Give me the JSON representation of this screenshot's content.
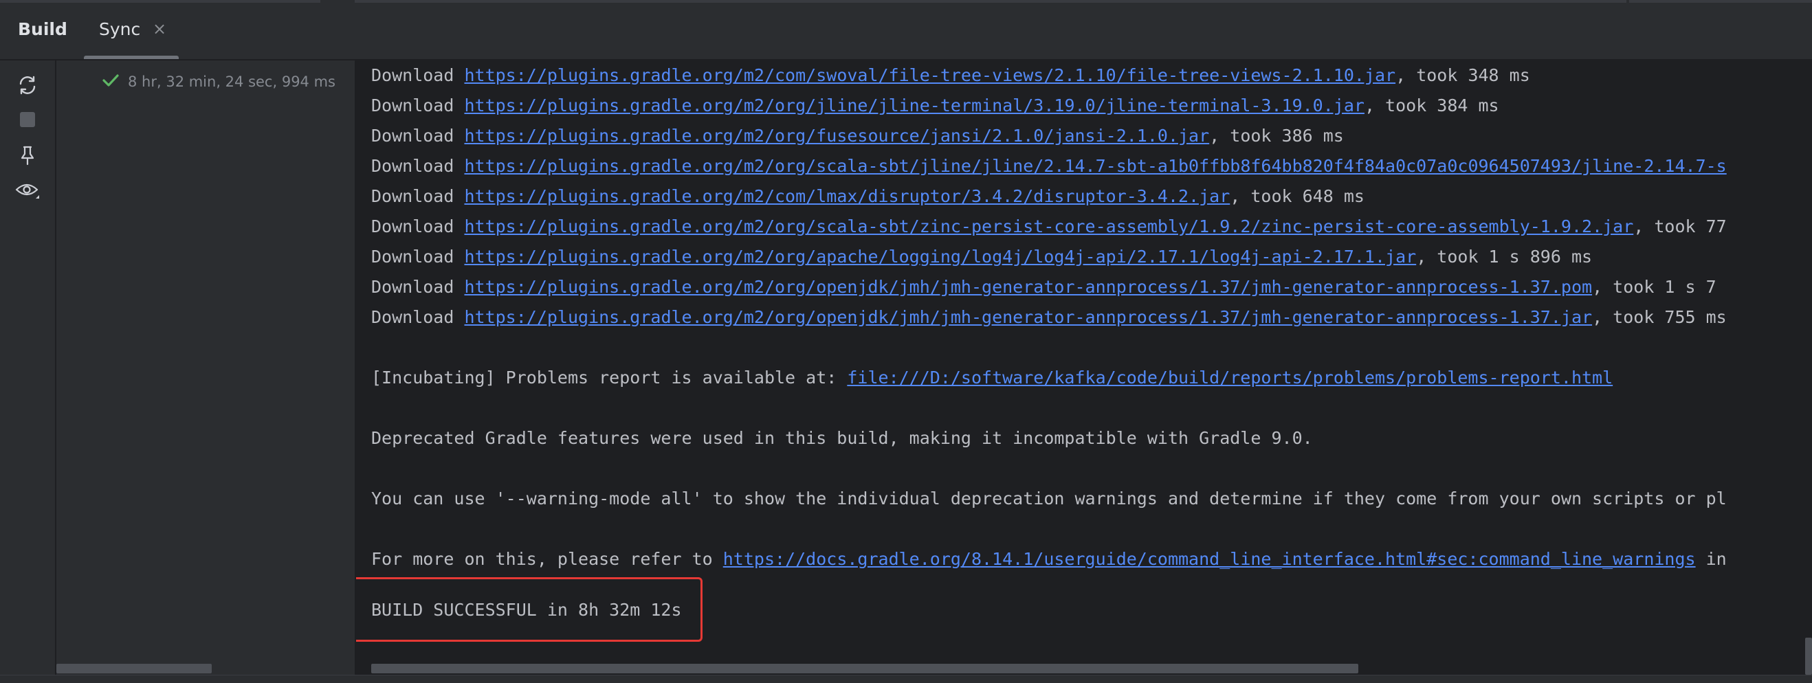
{
  "tabs": {
    "build_label": "Build",
    "sync_label": "Sync",
    "close_glyph": "×"
  },
  "toolbar_icons": [
    "sync-icon",
    "stop-icon",
    "pin-icon",
    "eye-icon"
  ],
  "tree": {
    "status_icon": "check-icon",
    "status_color": "#5fb865",
    "elapsed": "8 hr, 32 min, 24 sec, 994 ms"
  },
  "console": {
    "downloads": [
      {
        "prefix": "Download ",
        "url": "https://plugins.gradle.org/m2/com/swoval/file-tree-views/2.1.10/file-tree-views-2.1.10.jar",
        "suffix": ", took 348 ms"
      },
      {
        "prefix": "Download ",
        "url": "https://plugins.gradle.org/m2/org/jline/jline-terminal/3.19.0/jline-terminal-3.19.0.jar",
        "suffix": ", took 384 ms"
      },
      {
        "prefix": "Download ",
        "url": "https://plugins.gradle.org/m2/org/fusesource/jansi/2.1.0/jansi-2.1.0.jar",
        "suffix": ", took 386 ms"
      },
      {
        "prefix": "Download ",
        "url": "https://plugins.gradle.org/m2/org/scala-sbt/jline/jline/2.14.7-sbt-a1b0ffbb8f64bb820f4f84a0c07a0c0964507493/jline-2.14.7-s",
        "suffix": ""
      },
      {
        "prefix": "Download ",
        "url": "https://plugins.gradle.org/m2/com/lmax/disruptor/3.4.2/disruptor-3.4.2.jar",
        "suffix": ", took 648 ms"
      },
      {
        "prefix": "Download ",
        "url": "https://plugins.gradle.org/m2/org/scala-sbt/zinc-persist-core-assembly/1.9.2/zinc-persist-core-assembly-1.9.2.jar",
        "suffix": ", took 77"
      },
      {
        "prefix": "Download ",
        "url": "https://plugins.gradle.org/m2/org/apache/logging/log4j/log4j-api/2.17.1/log4j-api-2.17.1.jar",
        "suffix": ", took 1 s 896 ms"
      },
      {
        "prefix": "Download ",
        "url": "https://plugins.gradle.org/m2/org/openjdk/jmh/jmh-generator-annprocess/1.37/jmh-generator-annprocess-1.37.pom",
        "suffix": ", took 1 s 7"
      },
      {
        "prefix": "Download ",
        "url": "https://plugins.gradle.org/m2/org/openjdk/jmh/jmh-generator-annprocess/1.37/jmh-generator-annprocess-1.37.jar",
        "suffix": ", took 755 ms"
      }
    ],
    "problems_prefix": "[Incubating] Problems report is available at: ",
    "problems_url": "file:///D:/software/kafka/code/build/reports/problems/problems-report.html",
    "deprecated": "Deprecated Gradle features were used in this build, making it incompatible with Gradle 9.0.",
    "warning_mode": "You can use '--warning-mode all' to show the individual deprecation warnings and determine if they come from your own scripts or pl",
    "more_prefix": "For more on this, please refer to ",
    "more_url": "https://docs.gradle.org/8.14.1/userguide/command_line_interface.html#sec:command_line_warnings",
    "more_suffix": " in",
    "build_result": "BUILD SUCCESSFUL in 8h 32m 12s",
    "highlight_color": "#e53935"
  }
}
